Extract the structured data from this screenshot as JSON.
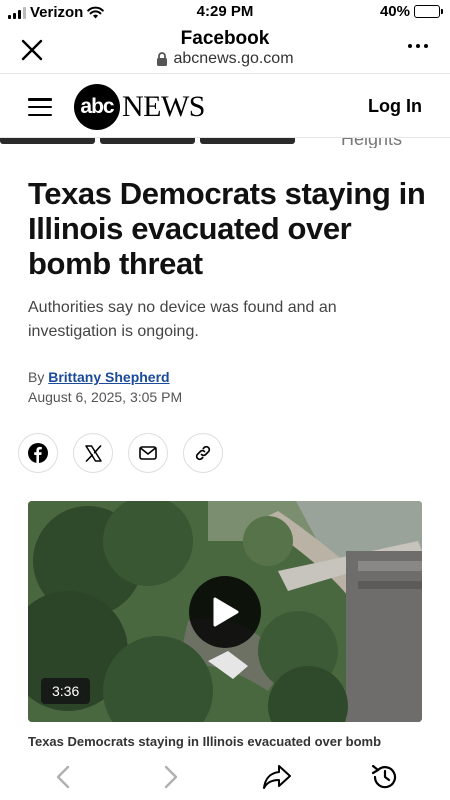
{
  "status_bar": {
    "carrier": "Verizon",
    "time": "4:29 PM",
    "battery_percent": "40%",
    "battery_level": 0.4
  },
  "browser": {
    "title": "Facebook",
    "url": "abcnews.go.com"
  },
  "site_nav": {
    "logo_circle_text": "abc",
    "logo_text": "NEWS",
    "login_label": "Log In"
  },
  "strip": {
    "caption_fragment": "Heights"
  },
  "article": {
    "headline": "Texas Democrats staying in Illinois evacuated over bomb threat",
    "subheadline": "Authorities say no device was found and an investigation is ongoing.",
    "byline_prefix": "By",
    "author": "Brittany Shepherd",
    "date": "August 6, 2025, 3:05 PM"
  },
  "share": {
    "icons": [
      "facebook-icon",
      "x-icon",
      "mail-icon",
      "link-icon"
    ]
  },
  "video": {
    "duration": "3:36",
    "caption": "Texas Democrats staying in Illinois evacuated over bomb"
  },
  "toolbar": {
    "icons": [
      "back-icon",
      "forward-icon",
      "share-icon",
      "history-icon"
    ]
  },
  "colors": {
    "link": "#1a4a9a",
    "text": "#111111",
    "muted": "#555555"
  }
}
